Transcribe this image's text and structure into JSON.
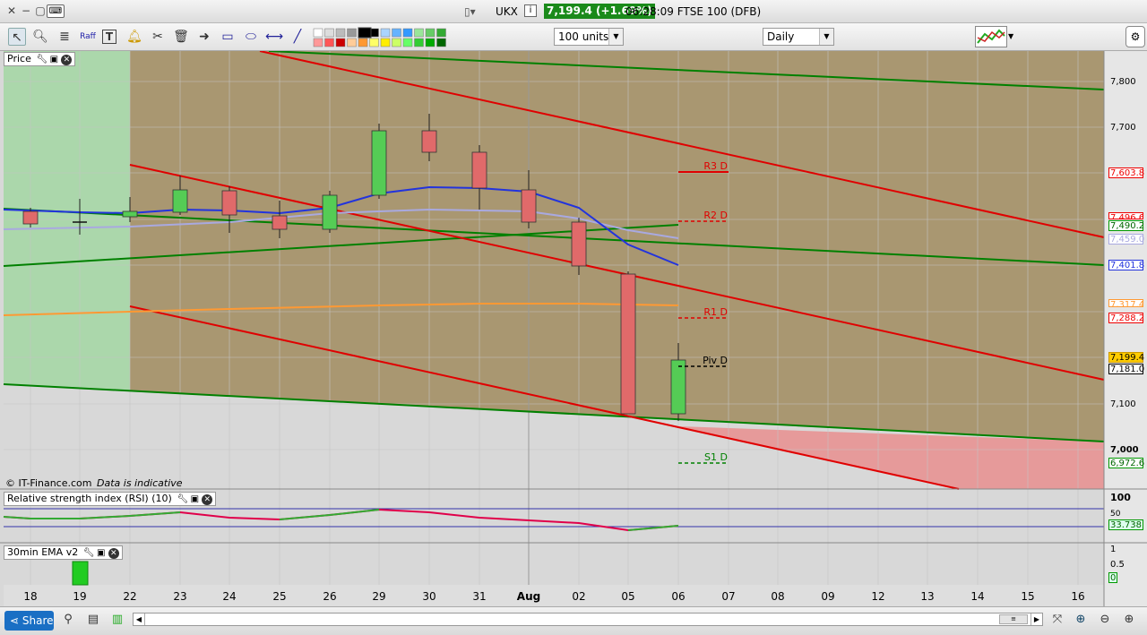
{
  "titlebar": {
    "symbol": "UKX",
    "price_badge": "7,199.4 (+1.69%)",
    "title_rest": "06:28:09 FTSE 100 (DFB)"
  },
  "toolbar": {
    "units_select": "100 units",
    "interval_select": "Daily"
  },
  "price_panel": {
    "title": "Price",
    "copyright": "© IT-Finance.com",
    "disclaimer": "Data is indicative",
    "pivots": {
      "r3": "R3 D",
      "r2": "R2 D",
      "r1": "R1 D",
      "piv": "Piv D",
      "s1": "S1 D"
    },
    "axis": [
      "7,800",
      "7,700",
      "7,100",
      "7,000"
    ],
    "tags": {
      "r3": "7,603.8",
      "r2": "7,496.6",
      "ma_green": "7,490.2",
      "ma_lav": "7,459.0",
      "ma_blue": "7,401.8",
      "ma_orange": "7,317.4",
      "r1": "7,288.2",
      "last": "7,199.4",
      "piv": "7,181.0",
      "s1": "6,972.6"
    }
  },
  "rsi_panel": {
    "title": "Relative strength index (RSI) (10)",
    "axis_top": "100",
    "axis_mid": "50",
    "value": "33.738"
  },
  "ema_panel": {
    "title": "30min EMA v2",
    "axis_1": "1",
    "axis_05": "0.5",
    "value": "0"
  },
  "dates": [
    "18",
    "19",
    "22",
    "23",
    "24",
    "25",
    "26",
    "29",
    "30",
    "31",
    "Aug",
    "02",
    "05",
    "06",
    "07",
    "08",
    "09",
    "12",
    "13",
    "14",
    "15",
    "16"
  ],
  "bottombar": {
    "share_label": "Share"
  },
  "colors": {
    "up": "#55cc55",
    "down": "#e06a6a",
    "resistance": "#e00000",
    "support": "#008000",
    "ma_blue": "#2233dd",
    "ma_lav": "#a9a9e0",
    "ma_orange": "#ff9933"
  }
}
